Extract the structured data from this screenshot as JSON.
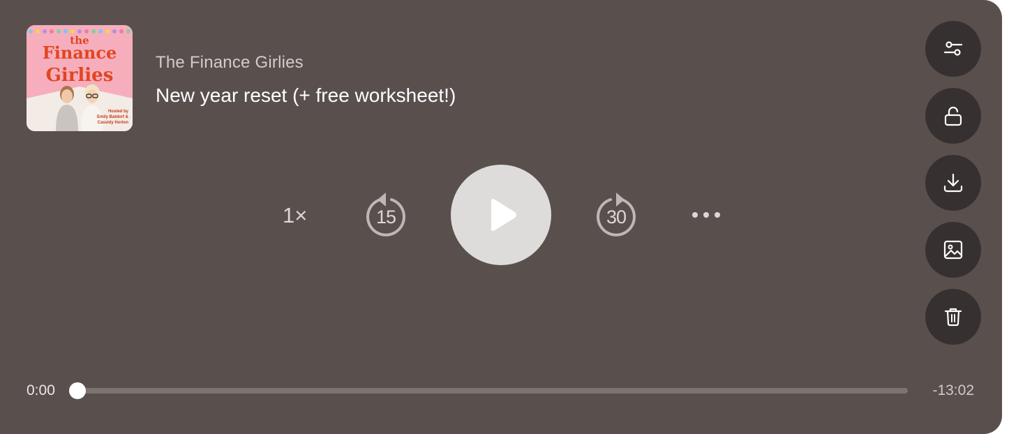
{
  "episode": {
    "show_name": "The Finance Girlies",
    "title": "New year reset (+ free worksheet!)"
  },
  "artwork": {
    "line1": "the",
    "line2": "Finance",
    "line3": "Girlies",
    "caption1": "Hosted by",
    "caption2": "Emily Batdorf &",
    "caption3": "Cassidy Horton",
    "bg_color": "#f6aebd",
    "title_color": "#e2451f"
  },
  "controls": {
    "speed_label": "1×",
    "skip_back_label": "15",
    "skip_forward_label": "30",
    "play_icon": "play-icon",
    "more_icon": "more-horizontal-icon"
  },
  "side_actions": [
    {
      "icon": "sliders-icon",
      "label": "settings"
    },
    {
      "icon": "unlock-icon",
      "label": "unlock"
    },
    {
      "icon": "download-icon",
      "label": "download"
    },
    {
      "icon": "image-icon",
      "label": "image"
    },
    {
      "icon": "trash-icon",
      "label": "delete"
    }
  ],
  "progress": {
    "elapsed": "0:00",
    "remaining": "-13:02",
    "fraction": 0
  },
  "colors": {
    "background": "#59504e",
    "button_bg": "#363130",
    "play_bg": "#dedcdb"
  }
}
